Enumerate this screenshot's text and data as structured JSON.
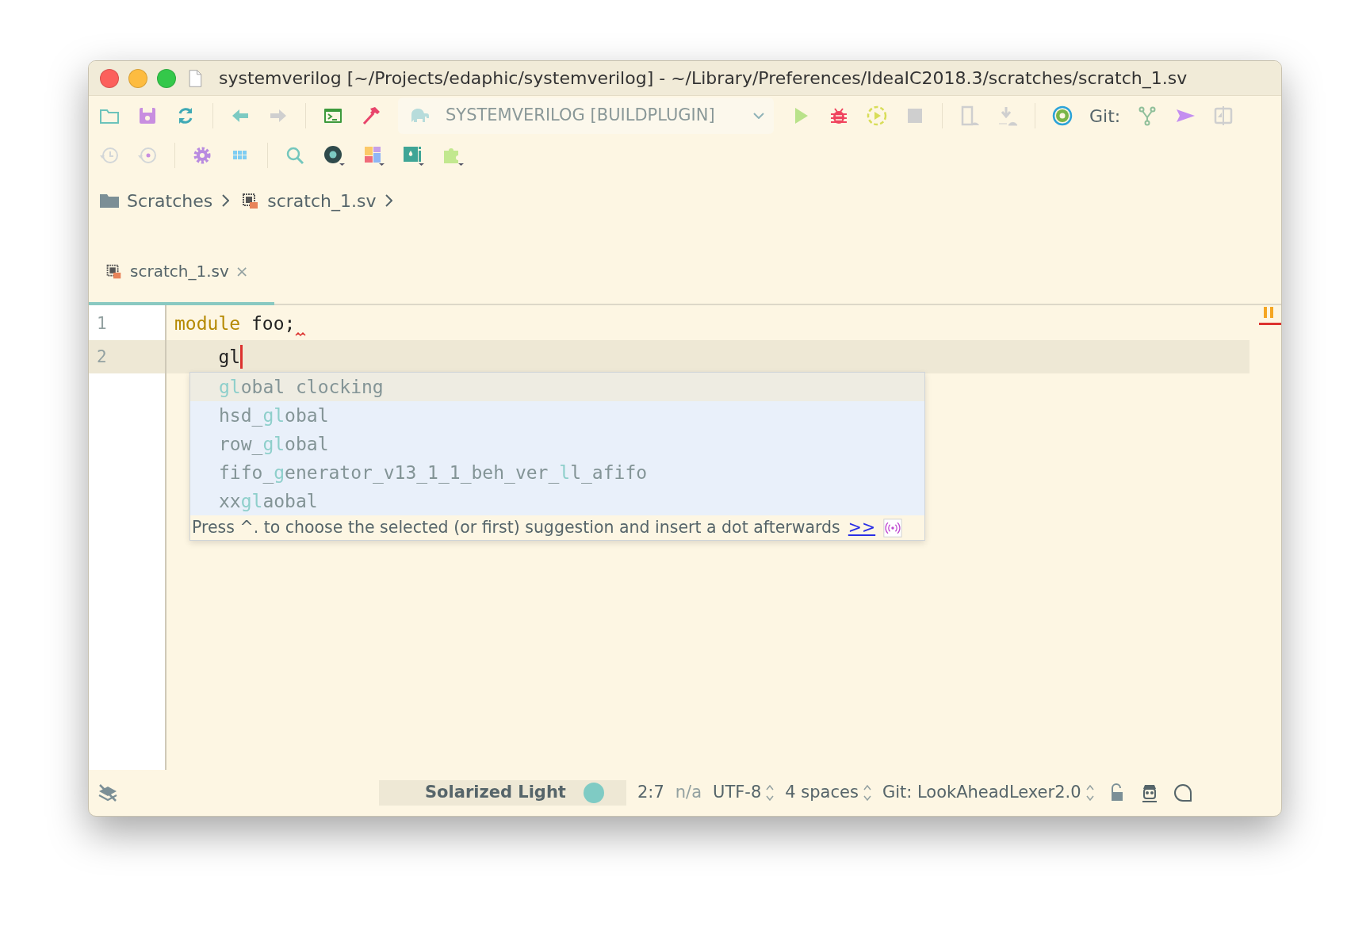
{
  "window": {
    "title": "systemverilog [~/Projects/edaphic/systemverilog] - ~/Library/Preferences/IdeaIC2018.3/scratches/scratch_1.sv"
  },
  "toolbar": {
    "run_config": "SYSTEMVERILOG [BUILDPLUGIN]",
    "git_label": "Git:"
  },
  "breadcrumbs": [
    "Scratches",
    "scratch_1.sv"
  ],
  "tabs": [
    {
      "label": "scratch_1.sv",
      "close": "×",
      "selected": true
    }
  ],
  "editor": {
    "lines": [
      {
        "number": "1",
        "current": false,
        "error": true,
        "tokens": [
          {
            "kind": "keyword",
            "text": "module"
          },
          {
            "kind": "plain",
            "text": " foo;"
          }
        ]
      },
      {
        "number": "2",
        "current": true,
        "error": false,
        "tokens": [
          {
            "kind": "plain",
            "text": "    gl"
          }
        ]
      }
    ]
  },
  "completion": {
    "items": [
      {
        "text": "**gl**obal clocking",
        "selected": true
      },
      {
        "text": "hsd_**gl**obal",
        "selected": false
      },
      {
        "text": "row_**gl**obal",
        "selected": false
      },
      {
        "text": "fifo_**g**enerator_v13_1_1_beh_ver_**l**l_afifo",
        "selected": false
      },
      {
        "text": "xx**gl**aobal",
        "selected": false
      }
    ],
    "hint": "Press ^. to choose the selected (or first) suggestion and insert a dot afterwards",
    "hint_link": ">>"
  },
  "status_bar": {
    "theme": "Solarized Light",
    "position": "2:7",
    "context": "n/a",
    "encoding": "UTF-8",
    "indent": "4 spaces",
    "branch": "Git: LookAheadLexer2.0"
  }
}
